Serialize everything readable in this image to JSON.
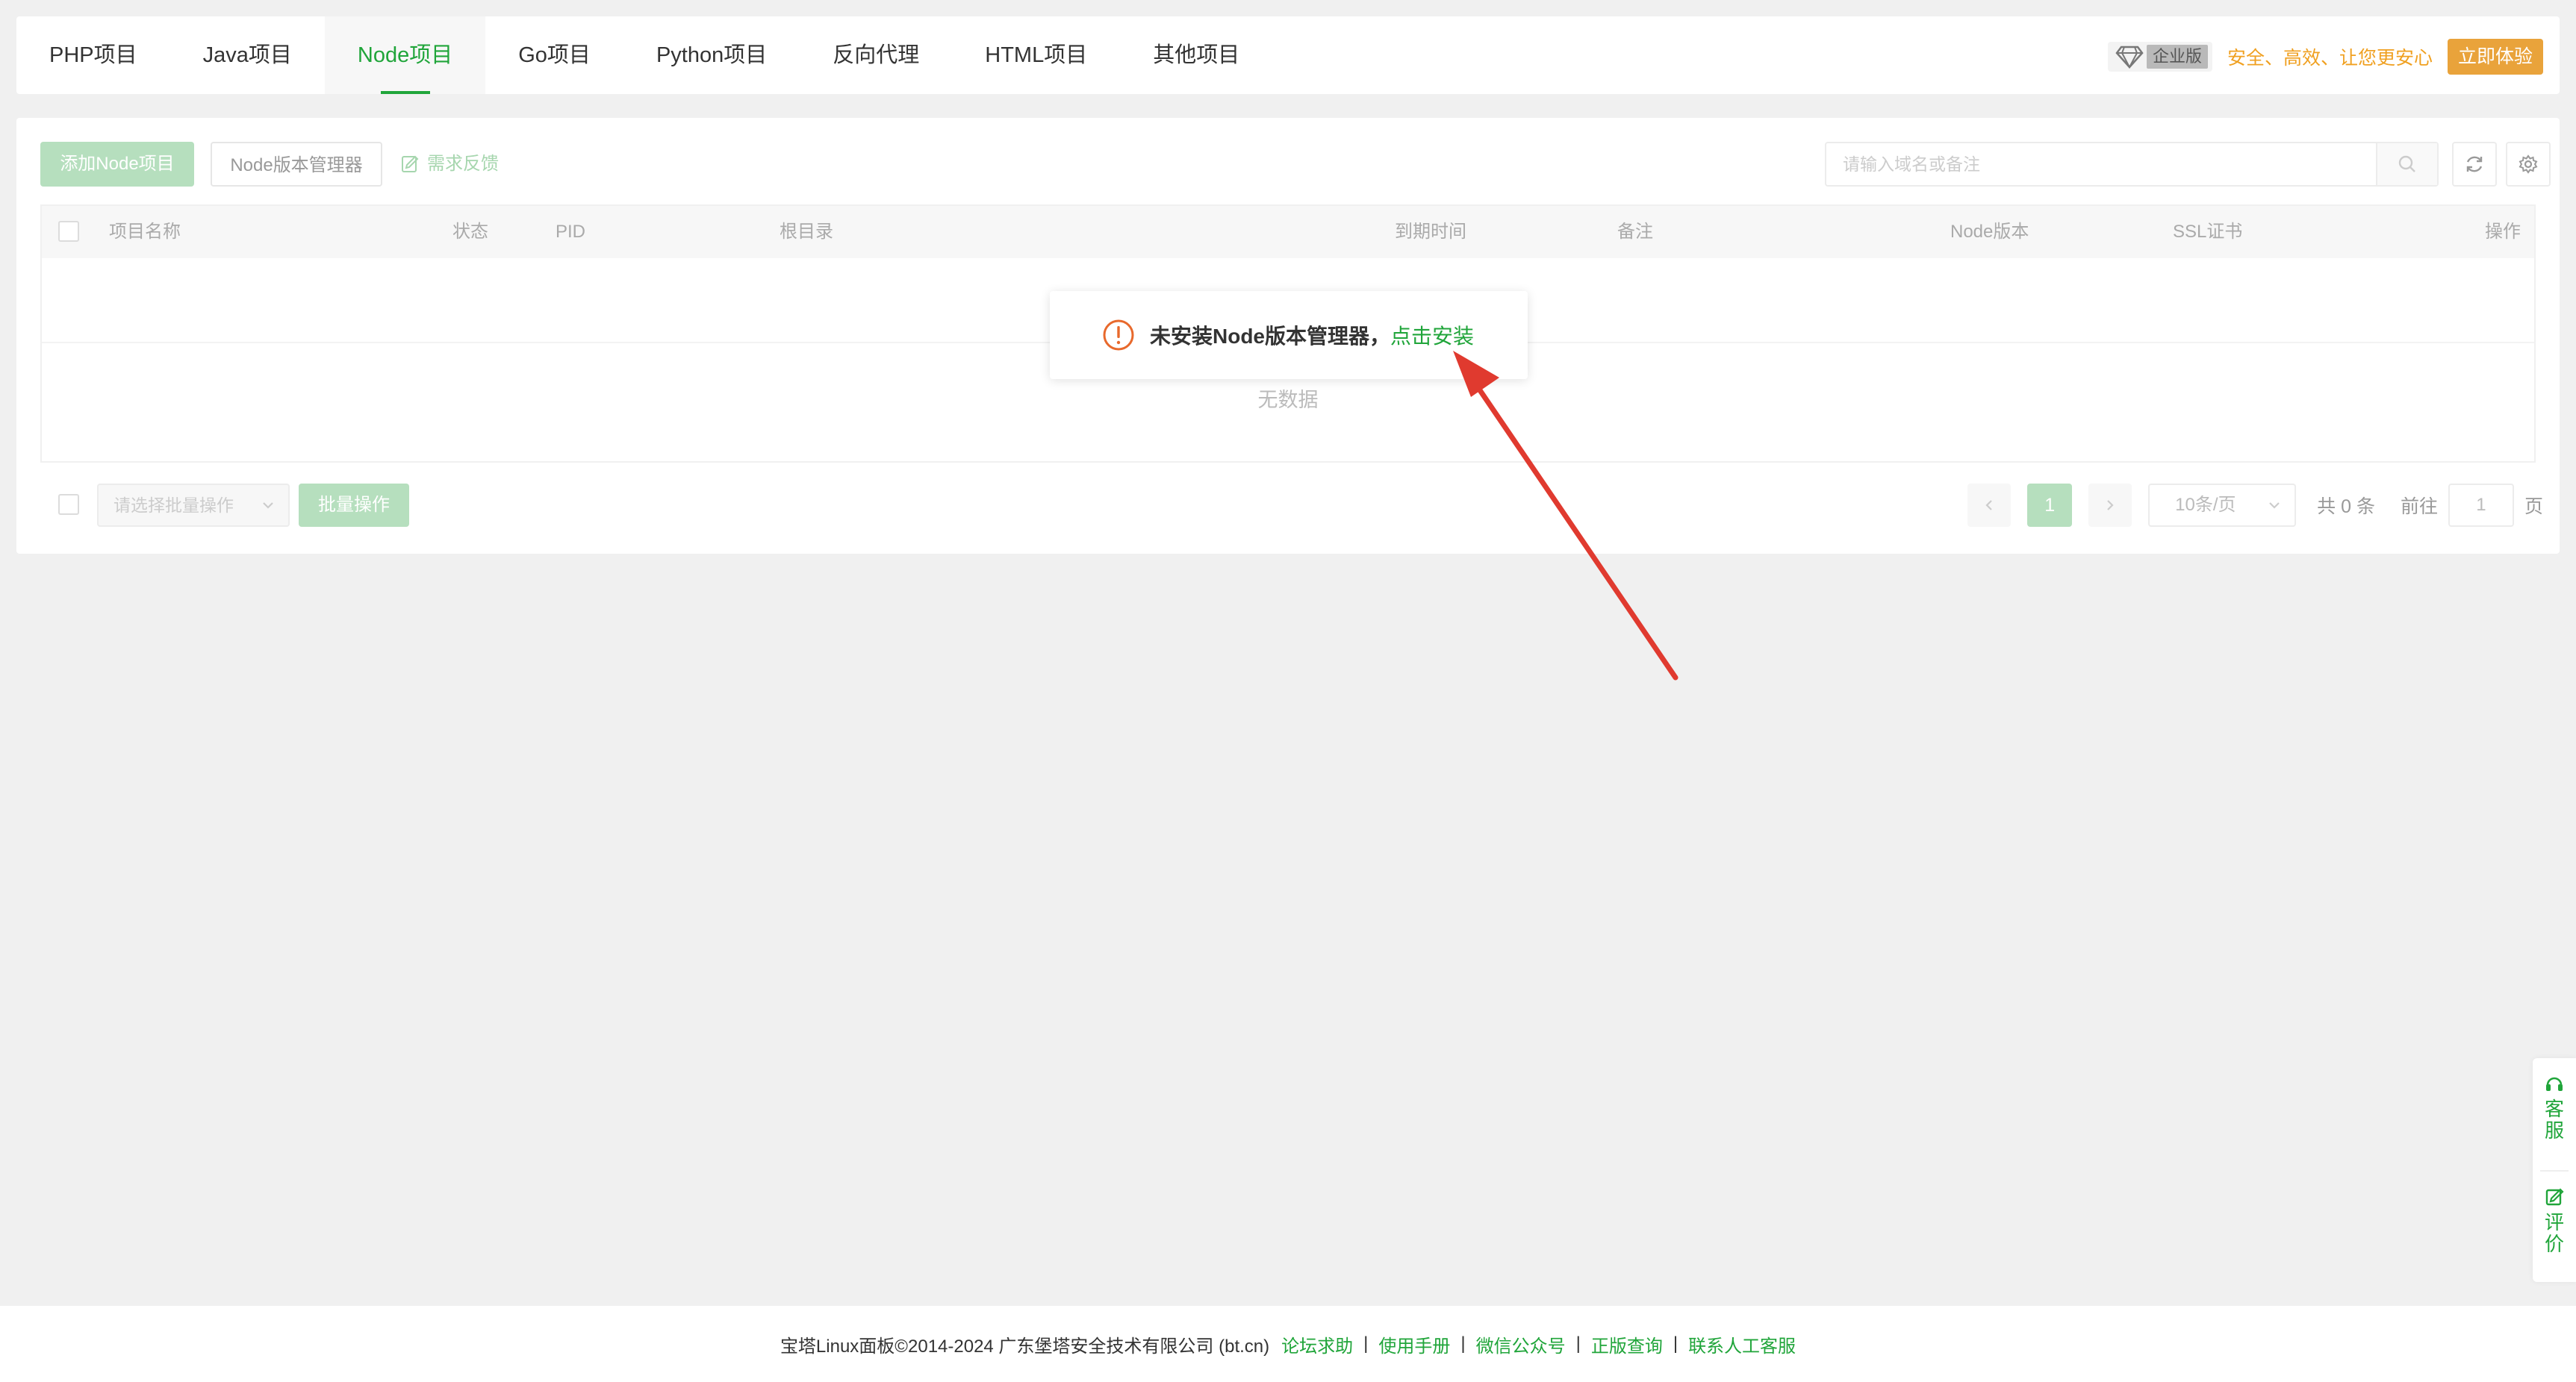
{
  "tabs": [
    {
      "label": "PHP项目"
    },
    {
      "label": "Java项目"
    },
    {
      "label": "Node项目"
    },
    {
      "label": "Go项目"
    },
    {
      "label": "Python项目"
    },
    {
      "label": "反向代理"
    },
    {
      "label": "HTML项目"
    },
    {
      "label": "其他项目"
    }
  ],
  "active_tab": "Node项目",
  "promo": {
    "badge": "企业版",
    "text": "安全、高效、让您更安心",
    "button": "立即体验"
  },
  "toolbar": {
    "add_button": "添加Node项目",
    "nvm_button": "Node版本管理器",
    "feedback": "需求反馈",
    "search_placeholder": "请输入域名或备注"
  },
  "table": {
    "columns": [
      "项目名称",
      "状态",
      "PID",
      "根目录",
      "到期时间",
      "备注",
      "Node版本",
      "SSL证书",
      "操作"
    ],
    "empty_text": "无数据"
  },
  "batch": {
    "select_placeholder": "请选择批量操作",
    "button": "批量操作"
  },
  "pagination": {
    "current_page": "1",
    "page_size": "10条/页",
    "total_text": "共 0 条",
    "goto_label": "前往",
    "goto_value": "1",
    "page_suffix": "页"
  },
  "toast": {
    "message": "未安装Node版本管理器，",
    "link": "点击安装"
  },
  "float_widget": {
    "service": "客服",
    "review": "评价"
  },
  "footer": {
    "copyright": "宝塔Linux面板©2014-2024 广东堡塔安全技术有限公司 (bt.cn)",
    "links": [
      "论坛求助",
      "使用手册",
      "微信公众号",
      "正版查询",
      "联系人工客服"
    ],
    "separator": "|"
  },
  "colors": {
    "brand_green": "#20a53a",
    "light_green": "#b6dfbe",
    "promo_orange": "#e9a33b",
    "warning_orange": "#e8692c",
    "arrow_red": "#e03a2f"
  },
  "icons": [
    "diamond-icon",
    "search-icon",
    "refresh-icon",
    "settings-icon",
    "edit-icon",
    "warning-icon",
    "headset-icon",
    "review-icon",
    "chevron-down-icon",
    "chevron-left-icon",
    "chevron-right-icon"
  ]
}
